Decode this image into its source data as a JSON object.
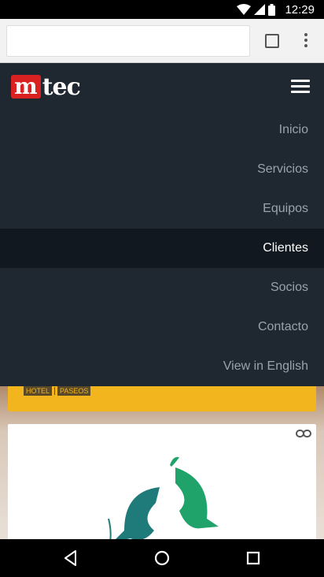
{
  "status_bar": {
    "time": "12:29"
  },
  "browser": {
    "url": "",
    "url_placeholder": ""
  },
  "site": {
    "logo": {
      "m": "m",
      "rest": "tec"
    },
    "menu": [
      {
        "label": "Inicio",
        "active": false
      },
      {
        "label": "Servicios",
        "active": false
      },
      {
        "label": "Equipos",
        "active": false
      },
      {
        "label": "Clientes",
        "active": true
      },
      {
        "label": "Socios",
        "active": false
      },
      {
        "label": "Contacto",
        "active": false
      },
      {
        "label": "View in English",
        "active": false
      }
    ],
    "tags": [
      "HOTEL",
      "PASEOS"
    ]
  },
  "colors": {
    "header_bg": "#1f2731",
    "active_item_bg": "#111820",
    "banner": "#f3b51e",
    "logo_red": "#d92121",
    "fish_dark": "#1f7a7a",
    "fish_green": "#1fa36a"
  },
  "icons": {
    "wifi": "wifi-icon",
    "signal": "signal-icon",
    "battery": "battery-icon",
    "tabs": "tabs-icon",
    "overflow_menu": "kebab-menu-icon",
    "hamburger": "hamburger-icon",
    "link": "link-icon",
    "back": "back-icon",
    "home": "home-icon",
    "recents": "recents-icon"
  }
}
